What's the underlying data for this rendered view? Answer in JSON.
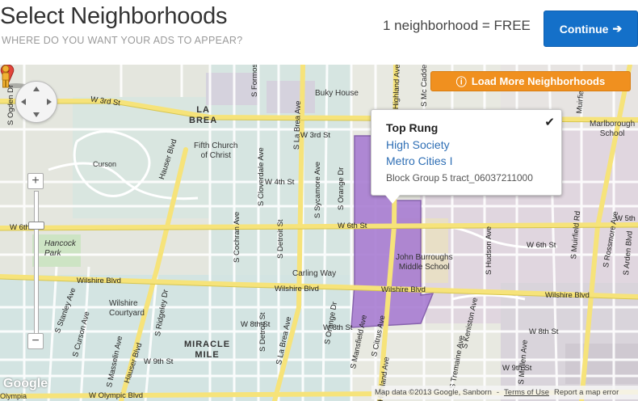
{
  "header": {
    "title": "Select Neighborhoods",
    "subtitle": "WHERE DO YOU WANT YOUR ADS TO APPEAR?",
    "count_text": "1 neighborhood = ",
    "count_price": "FREE",
    "continue_label": "Continue"
  },
  "map": {
    "load_more_label": "Load More Neighborhoods",
    "popup": {
      "title": "Top Rung",
      "link1": "High Society",
      "link2": "Metro Cities I",
      "meta": "Block Group 5 tract_06037211000"
    },
    "places": {
      "la_brea": "LA\nBREA",
      "la_brea_1": "LA",
      "la_brea_2": "BREA",
      "buky_house": "Buky House",
      "fifth_church_1": "Fifth Church",
      "fifth_church_2": "of Christ",
      "hancock_1": "Hancock",
      "hancock_2": "Park",
      "wilshire_courtyard_1": "Wilshire",
      "wilshire_courtyard_2": "Courtyard",
      "miracle_1": "MIRACLE",
      "miracle_2": "MILE",
      "carling_way": "Carling Way",
      "john_burroughs_1": "John Burroughs",
      "john_burroughs_2": "Middle School",
      "marlborough_1": "Marlborough",
      "marlborough_2": "School",
      "curson": "Curson",
      "olympia": "Olympia"
    },
    "roads": {
      "w3rd_left": "W 3rd St",
      "w3rd_mid": "W 3rd St",
      "w6th_left": "W 6th St",
      "w6th_mid": "W 6th St",
      "w6th_right": "W 6th St",
      "w5th": "W 5th",
      "w4th": "W 4th St",
      "wilshire_left": "Wilshire Blvd",
      "wilshire_mid": "Wilshire Blvd",
      "wilshire_mid2": "Wilshire Blvd",
      "wilshire_right": "Wilshire Blvd",
      "w8th_left": "W 8th St",
      "w8th_right": "W 8th St",
      "w8th_mid": "W 8th St",
      "w9th": "W 9th St",
      "w9th_right": "W 9th St",
      "olympic": "W Olympic Blvd",
      "hauser_top": "Hauser Blvd",
      "hauser_bottom": "Hauser Blvd",
      "la_brea_ave_top": "S La Brea Ave",
      "la_brea_ave_bottom": "S La Brea Ave",
      "highland_top": "Highland Ave",
      "highland_bottom": "Highland Ave",
      "cochran": "S Cochran Ave",
      "cloverdale": "S Cloverdale Ave",
      "detroit_top": "S Detroit St",
      "detroit_bottom": "S Detroit St",
      "sycamore": "S Sycamore Ave",
      "orange": "S Orange Dr",
      "orange2": "S Orange Dr",
      "mansfield": "S Mansfield Ave",
      "citrus": "S Citrus Ave",
      "stanley": "S Stanley Ave",
      "curson_ave": "S Curson Ave",
      "masselin": "S Masselin Ave",
      "ridgeley": "S Ridgeley Dr",
      "hudson": "S Hudson Ave",
      "muirfield": "S Muirfield Rd",
      "rossmore": "S Rossmore Ave",
      "arden": "S Arden Blvd",
      "mullen": "S Mullen Ave",
      "tremaine": "S Tremaine Ave",
      "keniston": "S Keniston Ave",
      "ogden": "S Ogden Dr",
      "formosa": "S Formosa Ave",
      "mc_cadden": "S Mc Cadden",
      "muirfield_top": "Muirfield Rd"
    },
    "attribution": {
      "data": "Map data ©2013 Google, Sanborn",
      "terms": "Terms of Use",
      "report": "Report a map error"
    },
    "google_logo": "Google",
    "zoom_in": "+",
    "zoom_out": "−",
    "colors": {
      "highlight_fill": "#a87dd2",
      "road_yellow": "#f6e37a",
      "accent_blue": "#1470c9",
      "accent_orange": "#f0901f"
    }
  }
}
